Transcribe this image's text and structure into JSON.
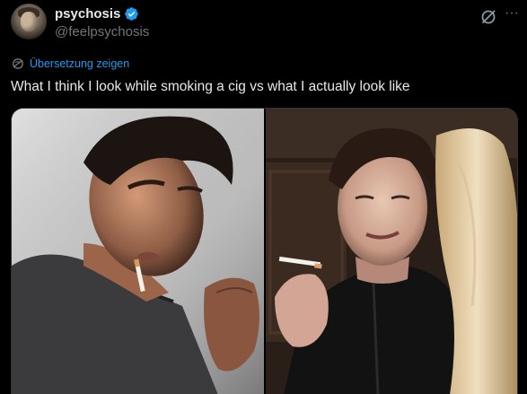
{
  "author": {
    "display_name": "psychosis",
    "handle": "@feelpsychosis",
    "verified": true,
    "verified_color": "#1d9bf0"
  },
  "actions": {
    "grok_icon": "grok-icon",
    "more_icon": "more-icon",
    "more_glyph": "···"
  },
  "translate": {
    "label": "Übersetzung zeigen",
    "icon": "translate-icon",
    "color": "#1d9bf0"
  },
  "tweet": {
    "text": "What I think I look while smoking a cig vs what I actually look like"
  },
  "media": {
    "count": 2
  },
  "theme": {
    "background": "#000000",
    "text": "#e7e9ea",
    "secondary_text": "#71767b",
    "accent": "#1d9bf0"
  }
}
